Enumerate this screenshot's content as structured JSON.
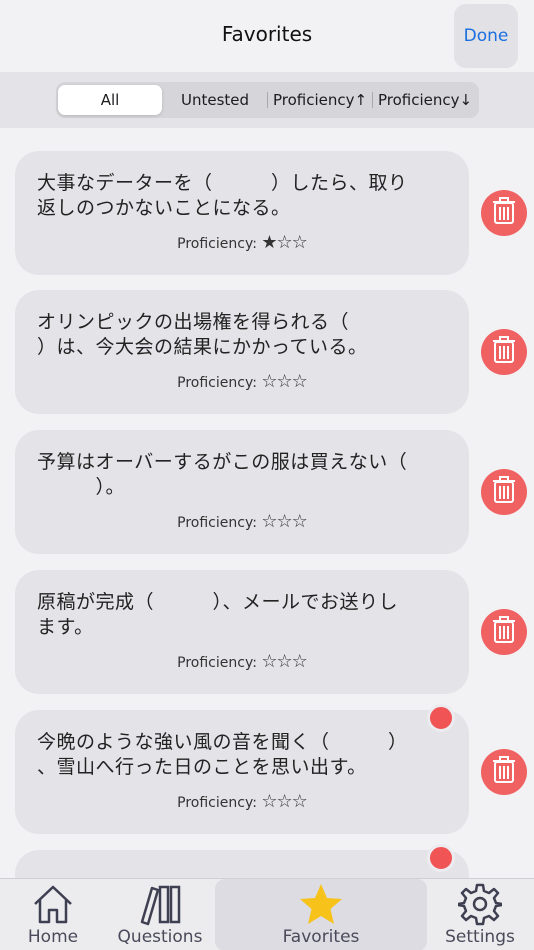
{
  "header": {
    "title": "Favorites",
    "done_label": "Done"
  },
  "filters": {
    "items": [
      "All",
      "Untested",
      "Proficiency↑",
      "Proficiency↓"
    ],
    "selected": "All"
  },
  "cards": [
    {
      "line1": "大事なデーターを（　　　）したら、取り",
      "line2": "返しのつかないことになる。",
      "prof_label": "Proficiency:",
      "stars": "★☆☆",
      "level": 1
    },
    {
      "line1": "オリンピックの出場権を得られる（　　　",
      "line2": "）は、今大会の結果にかかっている。",
      "prof_label": "Proficiency:",
      "stars": "☆☆☆",
      "level": 0
    },
    {
      "line1": "予算はオーバーするがこの服は買えない（",
      "line2": "　　　）。",
      "prof_label": "Proficiency:",
      "stars": "☆☆☆",
      "level": 0
    },
    {
      "line1": "原稿が完成（　　　）、メールでお送りし",
      "line2": "ます。",
      "prof_label": "Proficiency:",
      "stars": "☆☆☆",
      "level": 0
    },
    {
      "line1": "今晩のような強い風の音を聞く（　　　）",
      "line2": "、雪山へ行った日のことを思い出す。",
      "prof_label": "Proficiency:",
      "stars": "☆☆☆",
      "level": 0
    }
  ],
  "tabbar": {
    "home": "Home",
    "questions": "Questions",
    "favorites": "Favorites",
    "settings": "Settings",
    "active": "Favorites"
  },
  "colors": {
    "accent": "#1a6fe0",
    "delete": "#f06262",
    "star_active": "#f7c21a"
  },
  "icons": {
    "delete": "trash-icon",
    "home": "home-icon",
    "questions": "books-icon",
    "favorites": "star-icon",
    "settings": "gear-icon"
  }
}
